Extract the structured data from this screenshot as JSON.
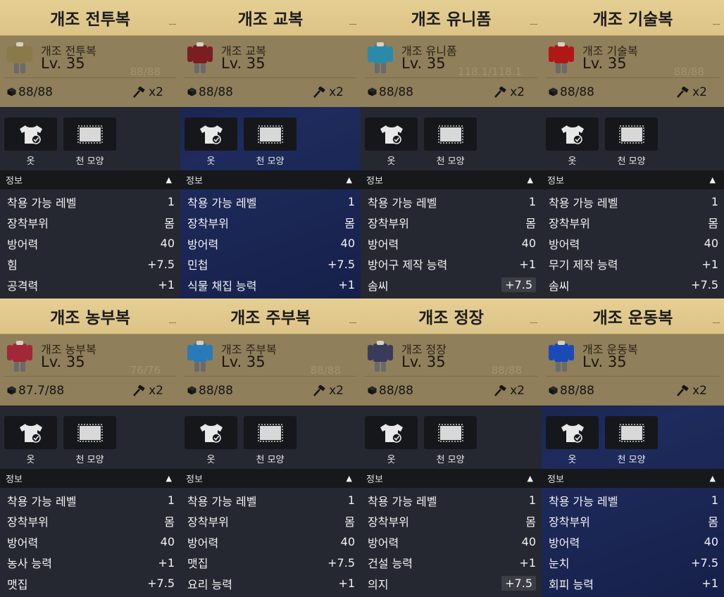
{
  "common": {
    "cloth_label": "옷",
    "pattern_label": "천 모양",
    "info_label": "정보",
    "collapse_arrow": "▲"
  },
  "icon_names": {
    "durability": "durability-cube-icon",
    "repair": "repair-hammer-icon",
    "cloth": "shirt-check-icon",
    "pattern": "fabric-pattern-icon"
  },
  "cards": [
    {
      "title": "개조 전투복",
      "name": "개조 전투복",
      "level": "Lv. 35",
      "ghost": "88/88",
      "durability": "88/88",
      "repair": "x2",
      "theme": "dark",
      "icon_color": "#8a7a4a",
      "stats": [
        {
          "label": "착용 가능 레벨",
          "value": "1"
        },
        {
          "label": "장착부위",
          "value": "몸"
        },
        {
          "label": "방어력",
          "value": "40"
        },
        {
          "label": "힘",
          "value": "+7.5"
        },
        {
          "label": "공격력",
          "value": "+1"
        }
      ]
    },
    {
      "title": "개조 교복",
      "name": "개조 교복",
      "level": "Lv. 35",
      "ghost": "",
      "durability": "88/88",
      "repair": "x2",
      "theme": "navy",
      "icon_color": "#7a1e22",
      "stats": [
        {
          "label": "착용 가능 레벨",
          "value": "1"
        },
        {
          "label": "장착부위",
          "value": "몸"
        },
        {
          "label": "방어력",
          "value": "40"
        },
        {
          "label": "민첩",
          "value": "+7.5"
        },
        {
          "label": "식물 채집 능력",
          "value": "+1"
        }
      ]
    },
    {
      "title": "개조 유니폼",
      "name": "개조 유니폼",
      "level": "Lv. 35",
      "ghost": "118.1/118.1",
      "durability": "88/88",
      "repair": "x2",
      "theme": "dark",
      "icon_color": "#2a8aa8",
      "stats": [
        {
          "label": "착용 가능 레벨",
          "value": "1"
        },
        {
          "label": "장착부위",
          "value": "몸"
        },
        {
          "label": "방어력",
          "value": "40"
        },
        {
          "label": "방어구 제작 능력",
          "value": "+1"
        },
        {
          "label": "솜씨",
          "value": "+7.5",
          "boxed": true
        }
      ]
    },
    {
      "title": "개조 기술복",
      "name": "개조 기술복",
      "level": "Lv. 35",
      "ghost": "88/88",
      "durability": "88/88",
      "repair": "x2",
      "theme": "dark",
      "icon_color": "#b01818",
      "stats": [
        {
          "label": "착용 가능 레벨",
          "value": "1"
        },
        {
          "label": "장착부위",
          "value": "몸"
        },
        {
          "label": "방어력",
          "value": "40"
        },
        {
          "label": "무기 제작 능력",
          "value": "+1"
        },
        {
          "label": "솜씨",
          "value": "+7.5"
        }
      ]
    },
    {
      "title": "개조 농부복",
      "name": "개조 농부복",
      "level": "Lv. 35",
      "ghost": "76/76",
      "durability": "87.7/88",
      "repair": "x2",
      "theme": "dark",
      "icon_color": "#a02838",
      "stats": [
        {
          "label": "착용 가능 레벨",
          "value": "1"
        },
        {
          "label": "장착부위",
          "value": "몸"
        },
        {
          "label": "방어력",
          "value": "40"
        },
        {
          "label": "농사 능력",
          "value": "+1"
        },
        {
          "label": "맷집",
          "value": "+7.5"
        }
      ]
    },
    {
      "title": "개조 주부복",
      "name": "개조 주부복",
      "level": "Lv. 35",
      "ghost": "88/88",
      "durability": "88/88",
      "repair": "x2",
      "theme": "dark",
      "icon_color": "#2a7ab8",
      "stats": [
        {
          "label": "착용 가능 레벨",
          "value": "1"
        },
        {
          "label": "장착부위",
          "value": "몸"
        },
        {
          "label": "방어력",
          "value": "40"
        },
        {
          "label": "맷집",
          "value": "+7.5"
        },
        {
          "label": "요리 능력",
          "value": "+1"
        }
      ]
    },
    {
      "title": "개조 정장",
      "name": "개조 정장",
      "level": "Lv. 35",
      "ghost": "88/88",
      "durability": "88/88",
      "repair": "x2",
      "theme": "dark",
      "icon_color": "#3a3a5a",
      "stats": [
        {
          "label": "착용 가능 레벨",
          "value": "1"
        },
        {
          "label": "장착부위",
          "value": "몸"
        },
        {
          "label": "방어력",
          "value": "40"
        },
        {
          "label": "건설 능력",
          "value": "+1"
        },
        {
          "label": "의지",
          "value": "+7.5",
          "boxed": true
        }
      ]
    },
    {
      "title": "개조 운동복",
      "name": "개조 운동복",
      "level": "Lv. 35",
      "ghost": "",
      "durability": "88/88",
      "repair": "x2",
      "theme": "navy",
      "icon_color": "#1a4ab8",
      "stats": [
        {
          "label": "착용 가능 레벨",
          "value": "1"
        },
        {
          "label": "장착부위",
          "value": "몸"
        },
        {
          "label": "방어력",
          "value": "40"
        },
        {
          "label": "눈치",
          "value": "+7.5"
        },
        {
          "label": "회피 능력",
          "value": "+1"
        }
      ]
    }
  ]
}
